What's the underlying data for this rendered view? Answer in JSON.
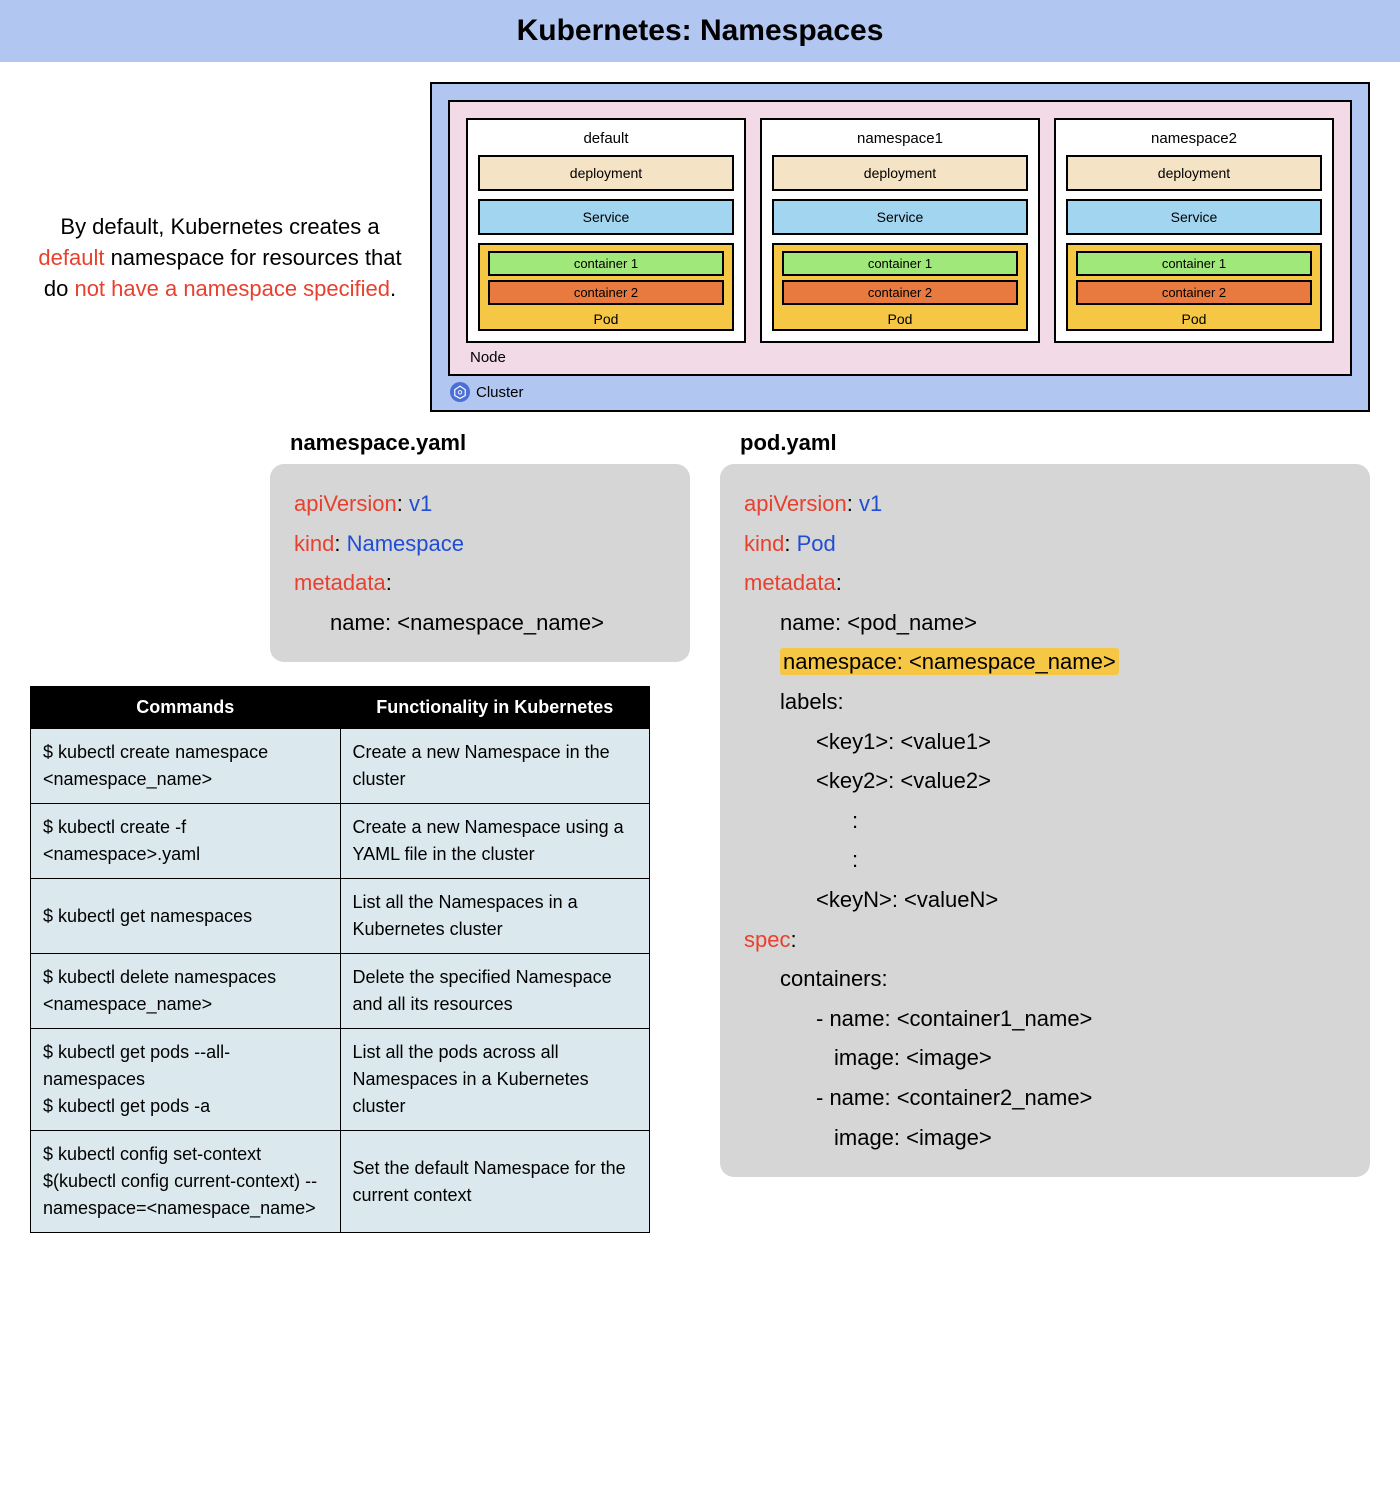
{
  "banner": {
    "title": "Kubernetes: Namespaces"
  },
  "intro": {
    "pre": "By default, Kubernetes creates a ",
    "default_word": "default",
    "mid": " namespace for resources that do ",
    "red_phrase": "not have a namespace specified",
    "post": "."
  },
  "cluster": {
    "label": "Cluster",
    "node_label": "Node",
    "namespaces": [
      {
        "name": "default",
        "deployment": "deployment",
        "service": "Service",
        "c1": "container 1",
        "c2": "container 2",
        "pod": "Pod"
      },
      {
        "name": "namespace1",
        "deployment": "deployment",
        "service": "Service",
        "c1": "container 1",
        "c2": "container 2",
        "pod": "Pod"
      },
      {
        "name": "namespace2",
        "deployment": "deployment",
        "service": "Service",
        "c1": "container 1",
        "c2": "container 2",
        "pod": "Pod"
      }
    ]
  },
  "files": {
    "namespace_title": "namespace.yaml",
    "pod_title": "pod.yaml",
    "ns_yaml": {
      "apiVersion_k": "apiVersion",
      "apiVersion_v": "v1",
      "kind_k": "kind",
      "kind_v": "Namespace",
      "metadata_k": "metadata",
      "name_line": "name: <namespace_name>"
    },
    "pod_yaml": {
      "apiVersion_k": "apiVersion",
      "apiVersion_v": "v1",
      "kind_k": "kind",
      "kind_v": "Pod",
      "metadata_k": "metadata",
      "name_line": "name: <pod_name>",
      "namespace_line": "namespace: <namespace_name>",
      "labels_k": "labels:",
      "kv1": "<key1>: <value1>",
      "kv2": "<key2>: <value2>",
      "colon1": ":",
      "colon2": ":",
      "kvn": "<keyN>: <valueN>",
      "spec_k": "spec",
      "containers_k": "containers:",
      "c1_name": "- name: <container1_name>",
      "c1_image": "image: <image>",
      "c2_name": "- name: <container2_name>",
      "c2_image": "image: <image>"
    }
  },
  "table": {
    "head_cmd": "Commands",
    "head_func": "Functionality in Kubernetes",
    "rows": [
      {
        "cmd": "$ kubectl create namespace <namespace_name>",
        "func": "Create a new Namespace in the cluster"
      },
      {
        "cmd": "$ kubectl create -f <namespace>.yaml",
        "func": "Create a new Namespace using a YAML file in the cluster"
      },
      {
        "cmd": "$ kubectl get namespaces",
        "func": "List all the Namespaces in a Kubernetes cluster"
      },
      {
        "cmd": "$ kubectl delete namespaces <namespace_name>",
        "func": "Delete the specified Namespace and all its resources"
      },
      {
        "cmd": "$ kubectl get pods --all-namespaces\n$ kubectl get pods -a",
        "func": "List all the pods across all Namespaces in a Kubernetes cluster"
      },
      {
        "cmd": "$ kubectl config set-context $(kubectl config current-context) --namespace=<namespace_name>",
        "func": "Set the default Namespace for the current context"
      }
    ]
  }
}
